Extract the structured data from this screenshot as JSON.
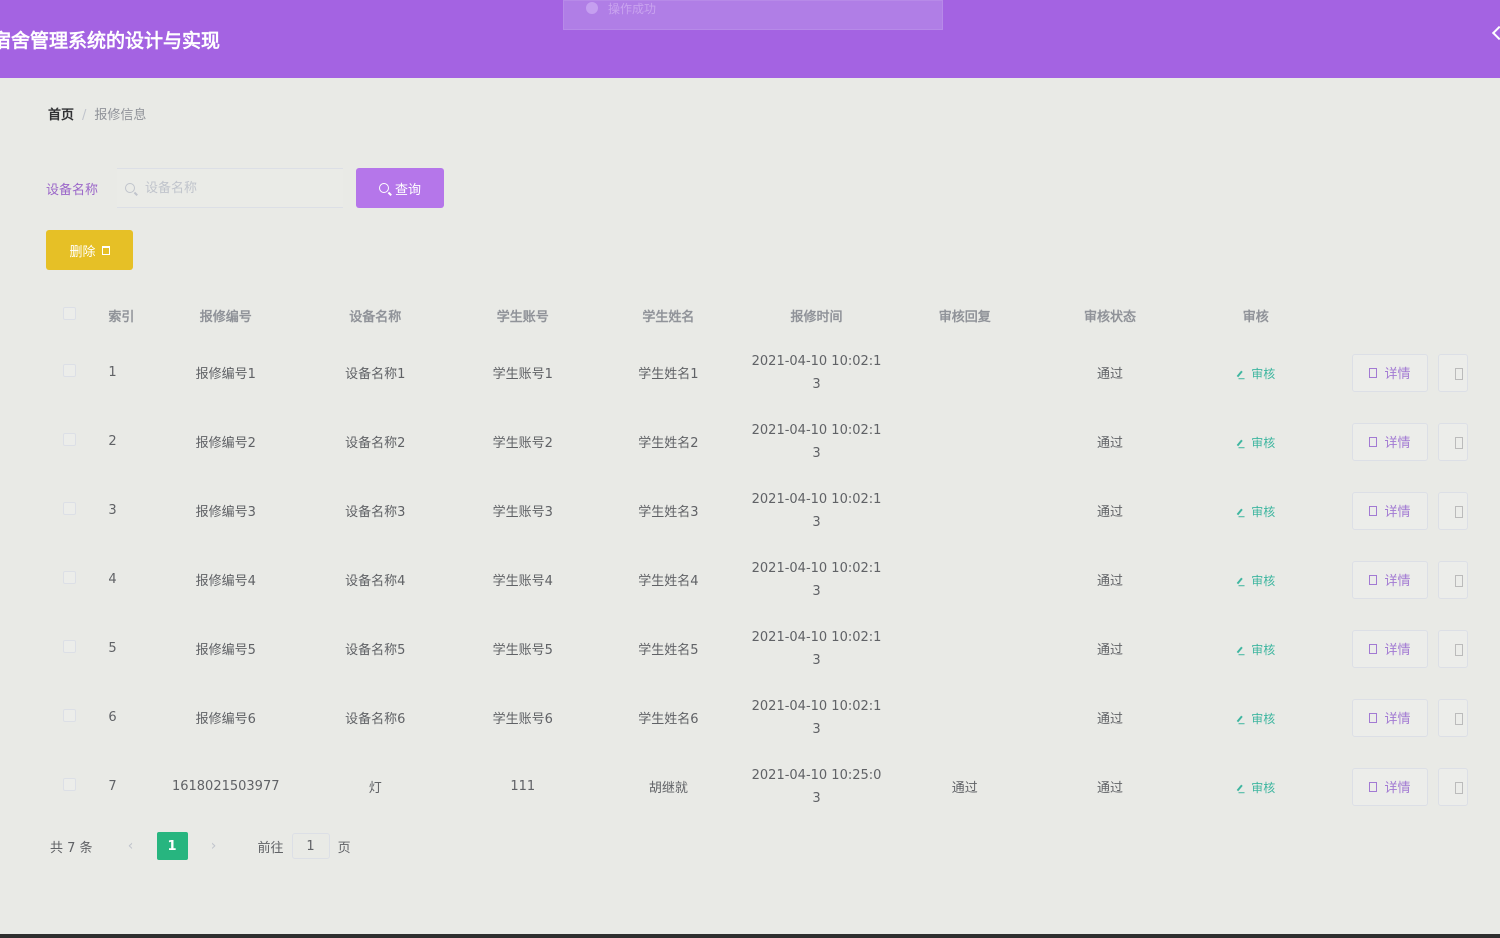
{
  "app": {
    "title": "宿舍管理系统的设计与实现"
  },
  "toast": {
    "text": "操作成功"
  },
  "breadcrumb": {
    "home": "首页",
    "separator": "/",
    "current": "报修信息"
  },
  "search": {
    "label": "设备名称",
    "placeholder": "设备名称",
    "value": "",
    "button": "查询"
  },
  "actions": {
    "delete": "删除"
  },
  "table": {
    "columns": [
      "索引",
      "报修编号",
      "设备名称",
      "学生账号",
      "学生姓名",
      "报修时间",
      "审核回复",
      "审核状态",
      "审核"
    ],
    "audit_link": "审核",
    "detail_button": "详情",
    "rows": [
      {
        "index": "1",
        "repair_no": "报修编号1",
        "device": "设备名称1",
        "account": "学生账号1",
        "name": "学生姓名1",
        "time": "2021-04-10 10:02:13",
        "reply": "",
        "status": "通过"
      },
      {
        "index": "2",
        "repair_no": "报修编号2",
        "device": "设备名称2",
        "account": "学生账号2",
        "name": "学生姓名2",
        "time": "2021-04-10 10:02:13",
        "reply": "",
        "status": "通过"
      },
      {
        "index": "3",
        "repair_no": "报修编号3",
        "device": "设备名称3",
        "account": "学生账号3",
        "name": "学生姓名3",
        "time": "2021-04-10 10:02:13",
        "reply": "",
        "status": "通过"
      },
      {
        "index": "4",
        "repair_no": "报修编号4",
        "device": "设备名称4",
        "account": "学生账号4",
        "name": "学生姓名4",
        "time": "2021-04-10 10:02:13",
        "reply": "",
        "status": "通过"
      },
      {
        "index": "5",
        "repair_no": "报修编号5",
        "device": "设备名称5",
        "account": "学生账号5",
        "name": "学生姓名5",
        "time": "2021-04-10 10:02:13",
        "reply": "",
        "status": "通过"
      },
      {
        "index": "6",
        "repair_no": "报修编号6",
        "device": "设备名称6",
        "account": "学生账号6",
        "name": "学生姓名6",
        "time": "2021-04-10 10:02:13",
        "reply": "",
        "status": "通过"
      },
      {
        "index": "7",
        "repair_no": "1618021503977",
        "device": "灯",
        "account": "111",
        "name": "胡继就",
        "time": "2021-04-10 10:25:03",
        "reply": "通过",
        "status": "通过"
      }
    ]
  },
  "pagination": {
    "total": "共 7 条",
    "prev": "‹",
    "current_page": "1",
    "next": "›",
    "goto_label": "前往",
    "goto_value": "1",
    "page_suffix": "页"
  },
  "colors": {
    "header": "#a463e2",
    "query_button": "#b576ea",
    "delete_button": "#e6c026",
    "active_page": "#27b57f",
    "audit_link": "#3fb6a0"
  }
}
